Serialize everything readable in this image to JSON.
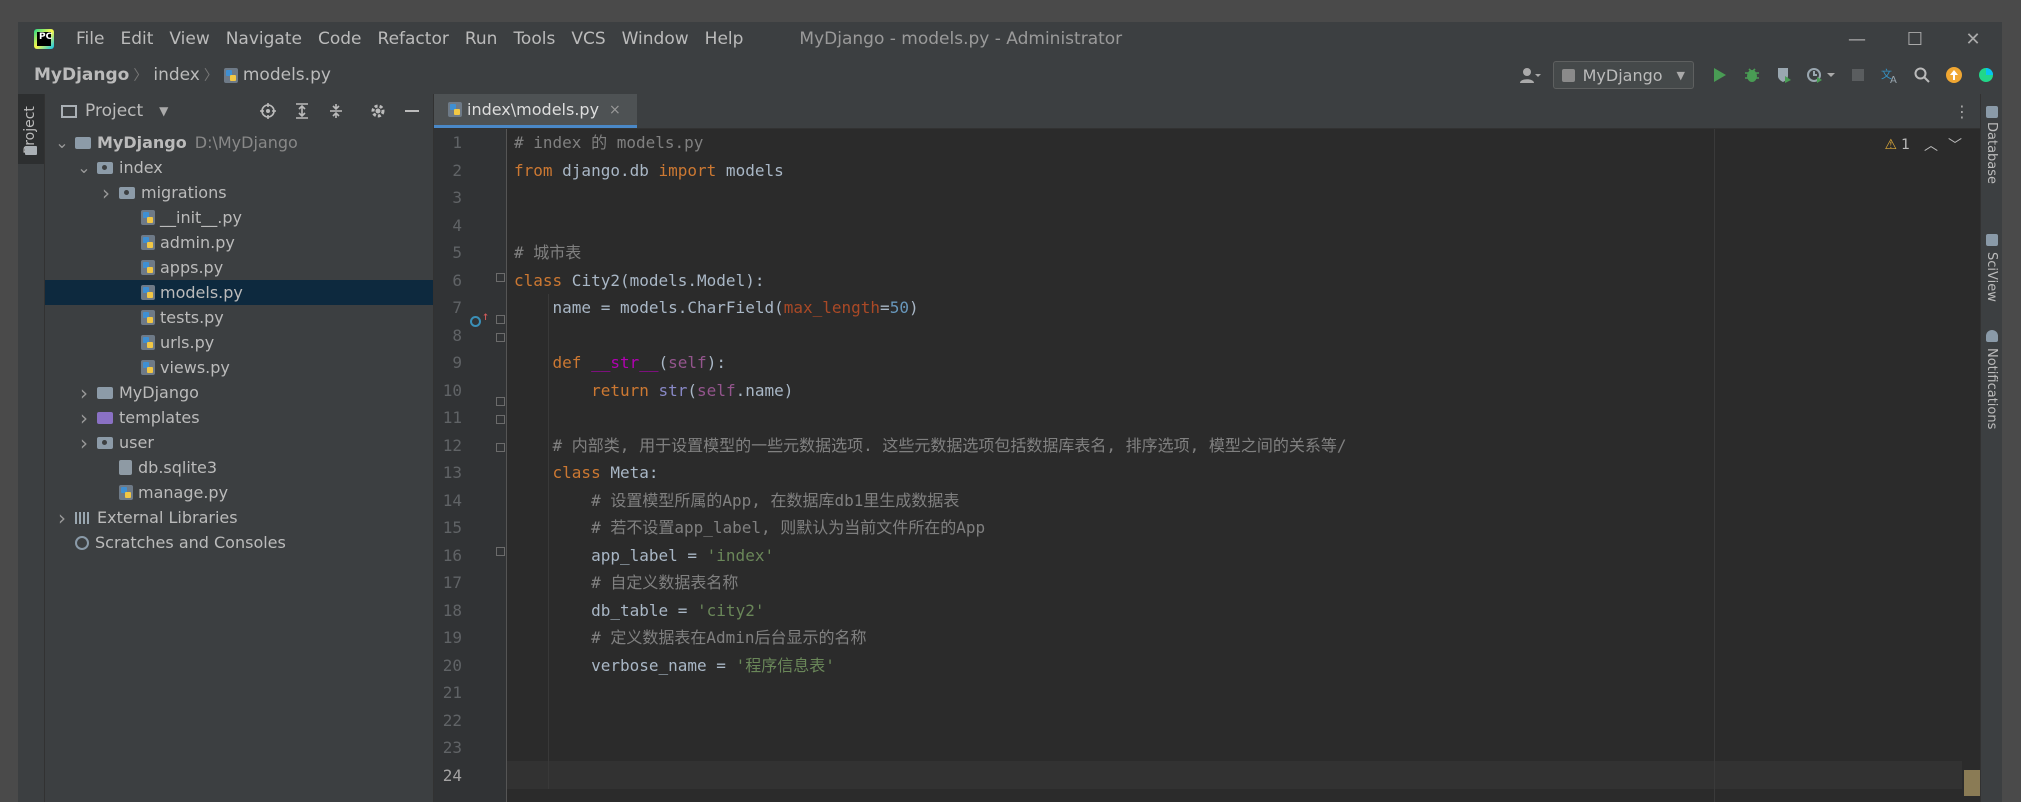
{
  "app": {
    "logo_text": "PC",
    "window_title": "MyDjango - models.py - Administrator"
  },
  "menu": [
    "File",
    "Edit",
    "View",
    "Navigate",
    "Code",
    "Refactor",
    "Run",
    "Tools",
    "VCS",
    "Window",
    "Help"
  ],
  "window_controls": {
    "minimize": "—",
    "maximize": "☐",
    "close": "✕"
  },
  "breadcrumb": [
    "MyDjango",
    "index",
    "models.py"
  ],
  "toolbar": {
    "run_config": "MyDjango",
    "icons": [
      "user-settings-icon",
      "run-icon",
      "debug-icon",
      "coverage-icon",
      "profile-icon",
      "stop-icon",
      "translate-icon",
      "search-icon",
      "update-icon",
      "jetbrains-icon"
    ]
  },
  "left_stripe": {
    "project_tab": "Project"
  },
  "project_panel": {
    "title": "Project",
    "tree": [
      {
        "label": "MyDjango",
        "hint": "D:\\MyDjango",
        "level": 0,
        "expand": "v",
        "icon": "folder",
        "bold": true
      },
      {
        "label": "index",
        "level": 1,
        "expand": "v",
        "icon": "folder-pkg"
      },
      {
        "label": "migrations",
        "level": 2,
        "expand": ">",
        "icon": "folder-pkg"
      },
      {
        "label": "__init__.py",
        "level": 3,
        "icon": "py"
      },
      {
        "label": "admin.py",
        "level": 3,
        "icon": "py"
      },
      {
        "label": "apps.py",
        "level": 3,
        "icon": "py"
      },
      {
        "label": "models.py",
        "level": 3,
        "icon": "py",
        "selected": true
      },
      {
        "label": "tests.py",
        "level": 3,
        "icon": "py"
      },
      {
        "label": "urls.py",
        "level": 3,
        "icon": "py"
      },
      {
        "label": "views.py",
        "level": 3,
        "icon": "py"
      },
      {
        "label": "MyDjango",
        "level": 1,
        "expand": ">",
        "icon": "folder"
      },
      {
        "label": "templates",
        "level": 1,
        "expand": ">",
        "icon": "folder-purple"
      },
      {
        "label": "user",
        "level": 1,
        "expand": ">",
        "icon": "folder-pkg"
      },
      {
        "label": "db.sqlite3",
        "level": 2,
        "icon": "db"
      },
      {
        "label": "manage.py",
        "level": 2,
        "icon": "py"
      },
      {
        "label": "External Libraries",
        "level": 0,
        "expand": ">",
        "icon": "lib"
      },
      {
        "label": "Scratches and Consoles",
        "level": 0,
        "icon": "scratch"
      }
    ]
  },
  "editor": {
    "tab_label": "index\\models.py",
    "tab_close": "×",
    "inspection": {
      "warnings": "1"
    },
    "line_numbers": [
      "1",
      "2",
      "3",
      "4",
      "5",
      "6",
      "7",
      "8",
      "9",
      "10",
      "11",
      "12",
      "13",
      "14",
      "15",
      "16",
      "17",
      "18",
      "19",
      "20",
      "21",
      "22",
      "23",
      "24"
    ],
    "lines": [
      [
        {
          "t": "# index 的 models.py",
          "c": "cm"
        }
      ],
      [
        {
          "t": "from",
          "c": "kw"
        },
        {
          "t": " django.db ",
          "c": ""
        },
        {
          "t": "import",
          "c": "kw"
        },
        {
          "t": " models",
          "c": ""
        }
      ],
      [],
      [],
      [
        {
          "t": "# 城市表",
          "c": "cm"
        }
      ],
      [
        {
          "t": "class",
          "c": "kw"
        },
        {
          "t": " City2(models.Model):",
          "c": ""
        }
      ],
      [
        {
          "t": "    name = models.CharField(",
          "c": ""
        },
        {
          "t": "max_length",
          "c": "param"
        },
        {
          "t": "=",
          "c": ""
        },
        {
          "t": "50",
          "c": "num"
        },
        {
          "t": ")",
          "c": ""
        }
      ],
      [],
      [
        {
          "t": "    ",
          "c": ""
        },
        {
          "t": "def",
          "c": "kw"
        },
        {
          "t": " ",
          "c": ""
        },
        {
          "t": "__str__",
          "c": "magic"
        },
        {
          "t": "(",
          "c": ""
        },
        {
          "t": "self",
          "c": "selfkw"
        },
        {
          "t": "):",
          "c": ""
        }
      ],
      [
        {
          "t": "        ",
          "c": ""
        },
        {
          "t": "return",
          "c": "kw"
        },
        {
          "t": " ",
          "c": ""
        },
        {
          "t": "str",
          "c": "builtin"
        },
        {
          "t": "(",
          "c": ""
        },
        {
          "t": "self",
          "c": "selfkw"
        },
        {
          "t": ".name)",
          "c": ""
        }
      ],
      [],
      [
        {
          "t": "    # 内部类, 用于设置模型的一些元数据选项. 这些元数据选项包括数据库表名, 排序选项, 模型之间的关系等/",
          "c": "cm"
        }
      ],
      [
        {
          "t": "    ",
          "c": ""
        },
        {
          "t": "class",
          "c": "kw"
        },
        {
          "t": " Meta:",
          "c": ""
        }
      ],
      [
        {
          "t": "        # 设置模型所属的App, 在数据库db1里生成数据表",
          "c": "cm"
        }
      ],
      [
        {
          "t": "        # 若不设置app_label, 则默认为当前文件所在的App",
          "c": "cm"
        }
      ],
      [
        {
          "t": "        app_label = ",
          "c": ""
        },
        {
          "t": "'index'",
          "c": "str"
        }
      ],
      [
        {
          "t": "        # 自定义数据表名称",
          "c": "cm"
        }
      ],
      [
        {
          "t": "        db_table = ",
          "c": ""
        },
        {
          "t": "'city2'",
          "c": "str"
        }
      ],
      [
        {
          "t": "        # 定义数据表在Admin后台显示的名称",
          "c": "cm"
        }
      ],
      [
        {
          "t": "        verbose_name = ",
          "c": ""
        },
        {
          "t": "'程序信息表'",
          "c": "str"
        }
      ],
      [],
      [],
      [],
      []
    ]
  },
  "right_stripe": [
    "Database",
    "SciView",
    "Notifications"
  ]
}
